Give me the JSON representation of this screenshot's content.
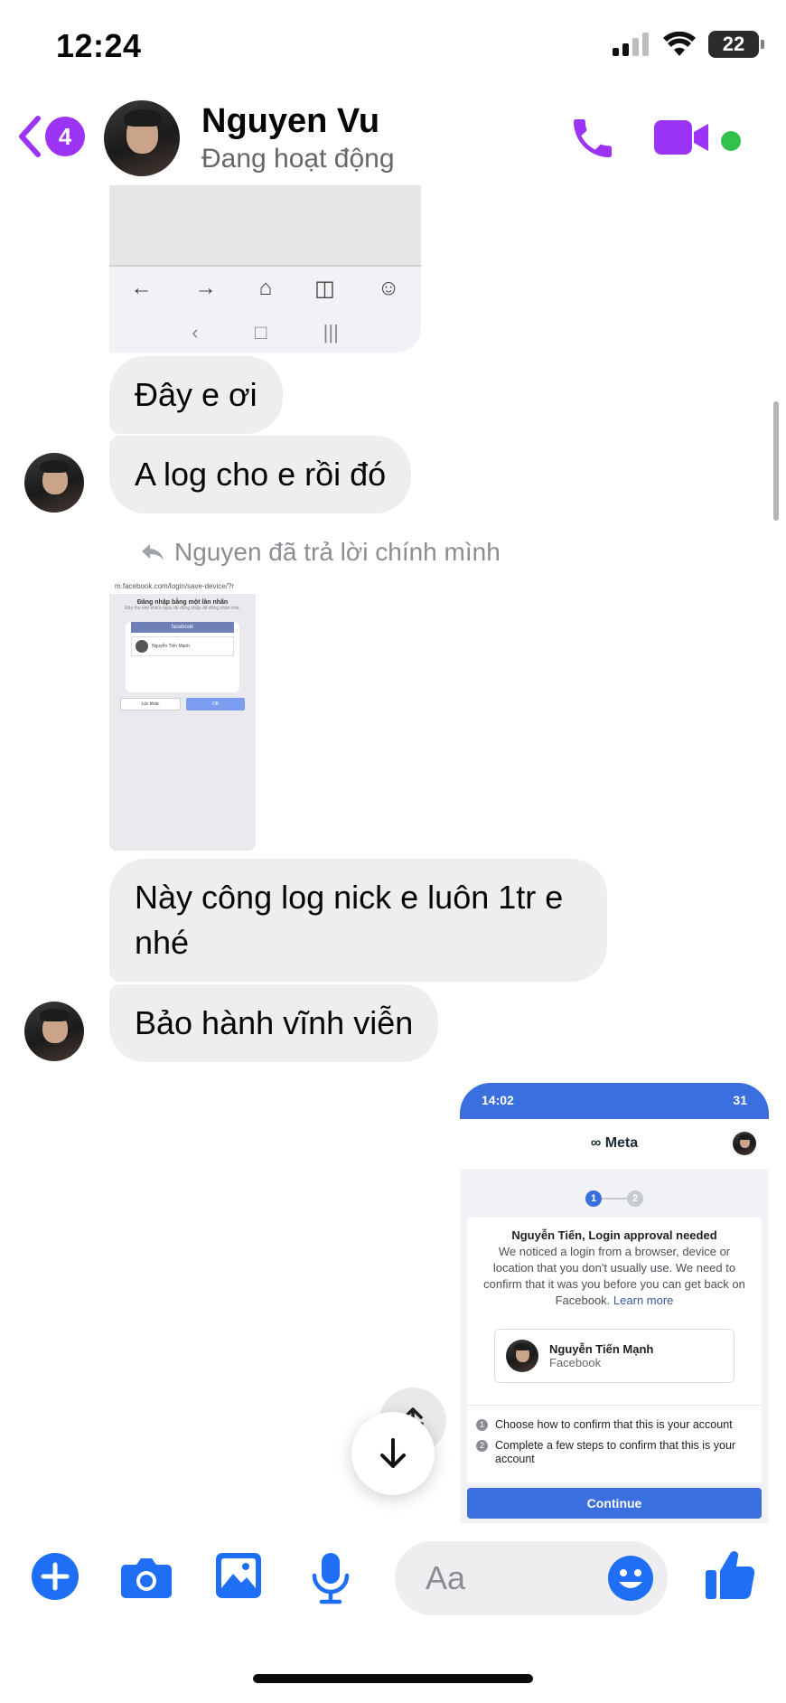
{
  "status_bar": {
    "time": "12:24",
    "battery": "22"
  },
  "header": {
    "back_badge": "4",
    "name": "Nguyen Vu",
    "status": "Đang hoạt động"
  },
  "messages": [
    {
      "text": "Đây e ơi"
    },
    {
      "text": "A log cho e rồi đó"
    },
    {
      "reply_note": "Nguyen đã trả lời chính mình"
    },
    {
      "text": "Này công log nick e luôn 1tr e nhé"
    },
    {
      "text": "Bảo hành vĩnh viễn"
    }
  ],
  "attachment_small": {
    "url": "m.facebook.com/login/save-device/?r",
    "title": "Đăng nhập bằng một lần nhấn",
    "subtitle": "Đây thu nhỏ khiến ngay để đăng nhập để đăng nhân nhà.",
    "brand": "facebook",
    "account": "Nguyễn Tiến Mạnh",
    "btn_secondary": "Lúc khác",
    "btn_primary": "OK"
  },
  "attachment_fb": {
    "time": "14:02",
    "battery": "31",
    "brand": "Meta",
    "step1": "1",
    "step2": "2",
    "heading": "Nguyễn Tiến, Login approval needed",
    "body": "We noticed a login from a browser, device or location that you don't usually use. We need to confirm that it was you before you can get back on Facebook.",
    "learn_more": "Learn more",
    "account_name": "Nguyễn Tiến Mạnh",
    "account_sub": "Facebook",
    "list": [
      "Choose how to confirm that this is your account",
      "Complete a few steps to confirm that this is your account"
    ],
    "continue": "Continue"
  },
  "composer": {
    "placeholder": "Aa"
  },
  "colors": {
    "accent_purple": "#9b34f5",
    "accent_blue": "#1e6ff5",
    "bubble": "#eeeef0",
    "online": "#31c24d"
  },
  "icons": [
    "back-chevron-icon",
    "phone-icon",
    "video-icon",
    "share-icon",
    "arrow-down-icon",
    "plus-icon",
    "camera-icon",
    "gallery-icon",
    "mic-icon",
    "emoji-icon",
    "like-icon"
  ]
}
